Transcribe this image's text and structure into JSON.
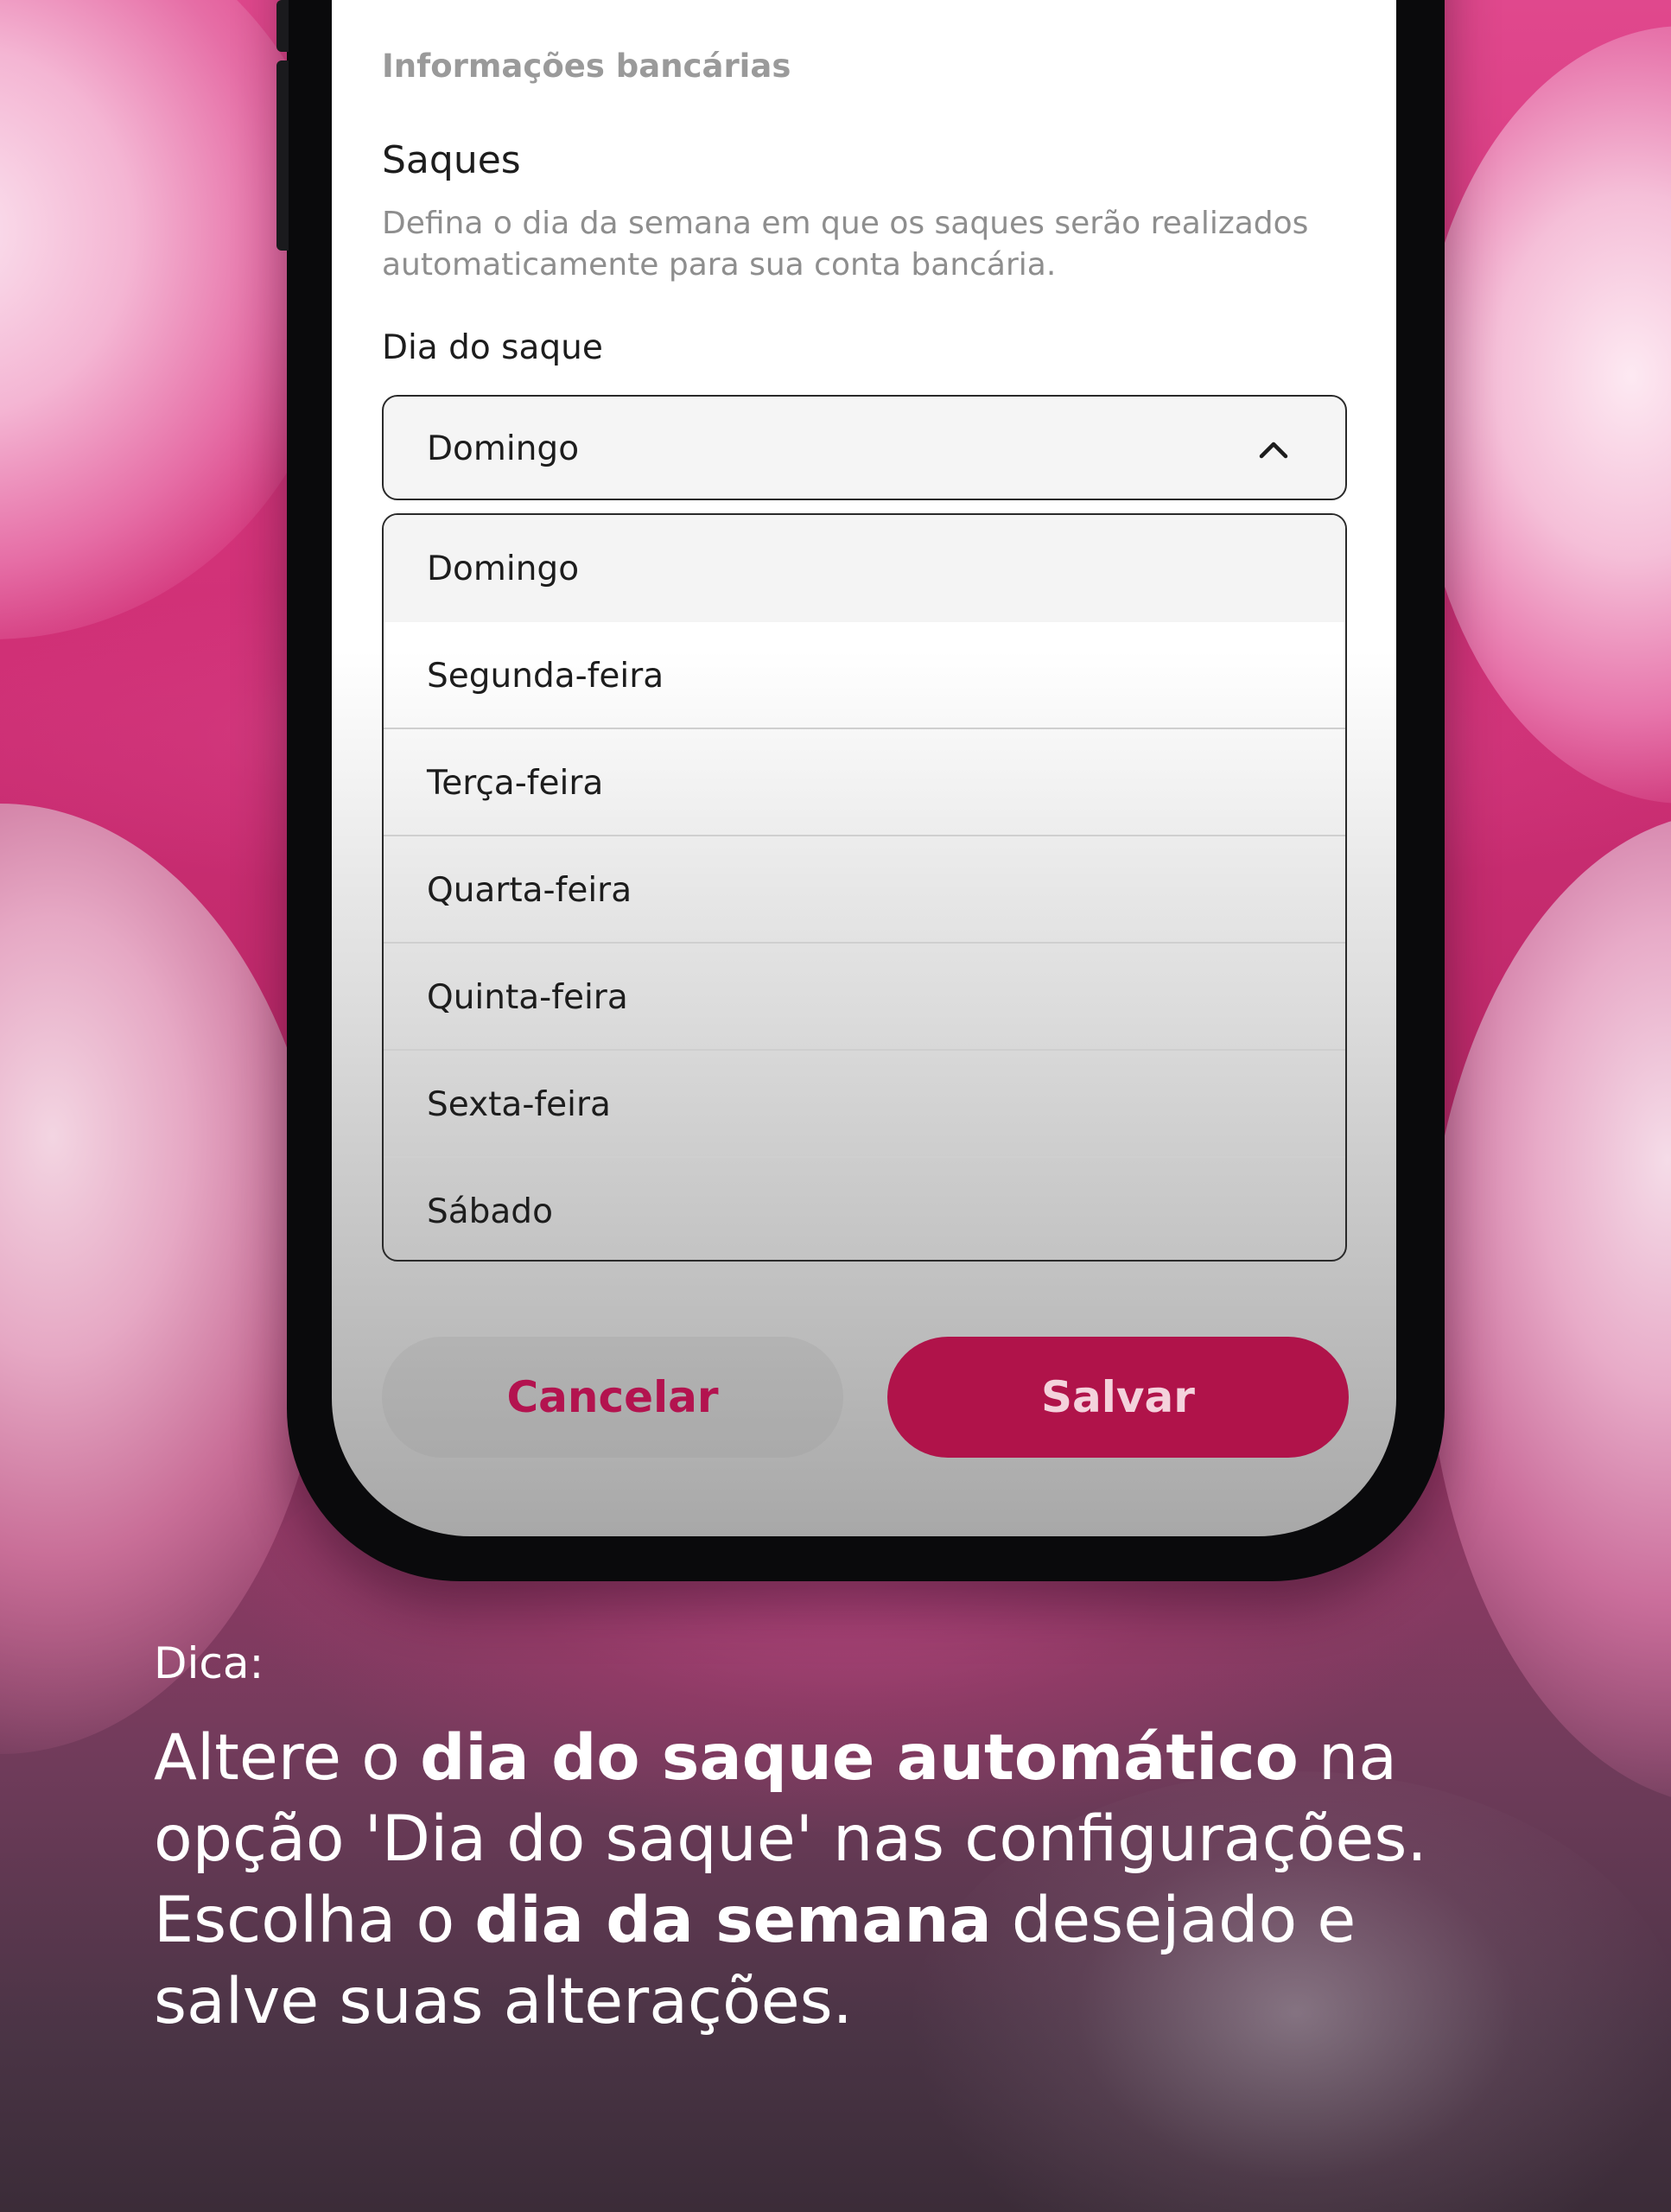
{
  "screen": {
    "section_header": "Informações bancárias",
    "withdrawals": {
      "title": "Saques",
      "description": "Defina o dia da semana em que os saques serão realizados automaticamente para sua conta bancária.",
      "field_label": "Dia do saque",
      "selected_value": "Domingo",
      "options": [
        {
          "label": "Domingo",
          "selected": true
        },
        {
          "label": "Segunda-feira",
          "selected": false
        },
        {
          "label": "Terça-feira",
          "selected": false
        },
        {
          "label": "Quarta-feira",
          "selected": false
        },
        {
          "label": "Quinta-feira",
          "selected": false
        },
        {
          "label": "Sexta-feira",
          "selected": false
        },
        {
          "label": "Sábado",
          "selected": false
        }
      ]
    },
    "buttons": {
      "cancel_label": "Cancelar",
      "save_label": "Salvar"
    }
  },
  "caption": {
    "kicker": "Dica:",
    "line1_a": "Altere o ",
    "line1_b": "dia do saque automático",
    "line1_c": " na",
    "line2": "opção 'Dia do saque' nas configurações.",
    "line3_a": "Escolha o ",
    "line3_b": "dia da semana",
    "line3_c": " desejado e",
    "line4": "salve suas alterações."
  },
  "icons": {
    "dropdown_toggle": "chevron-up-icon"
  },
  "colors": {
    "primary": "#b0134a",
    "cancel_text": "#b3134f",
    "background_pink": "#d6397f"
  }
}
